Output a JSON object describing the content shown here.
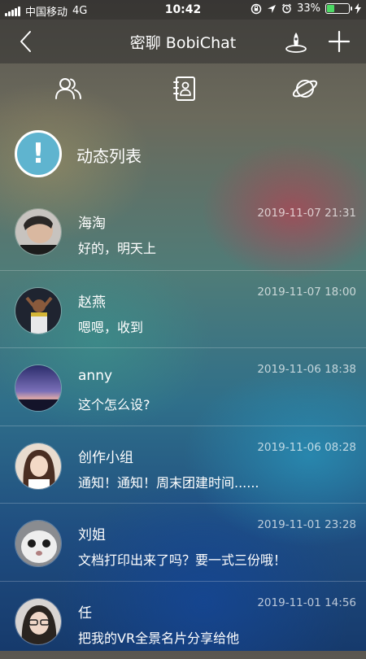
{
  "status_bar": {
    "carrier": "中国移动",
    "network": "4G",
    "time": "10:42",
    "battery_text": "33%",
    "battery_level": 0.33,
    "icons": [
      "signal-icon",
      "lock-rotation-icon",
      "location-icon",
      "alarm-icon",
      "battery-icon",
      "charging-icon"
    ]
  },
  "nav": {
    "title": "密聊 BobiChat",
    "icons": [
      "back-icon",
      "rocket-icon",
      "add-icon"
    ]
  },
  "tabs": [
    {
      "icon": "contacts-icon"
    },
    {
      "icon": "address-book-icon"
    },
    {
      "icon": "planet-icon"
    }
  ],
  "feed_header": {
    "title": "动态列表",
    "icon": "info-icon"
  },
  "conversations": [
    {
      "name": "海淘",
      "message": "好的，明天上",
      "time": "2019-11-07 21:31"
    },
    {
      "name": "赵燕",
      "message": "嗯嗯，收到",
      "time": "2019-11-07 18:00"
    },
    {
      "name": "anny",
      "message": "这个怎么设?",
      "time": "2019-11-06 18:38"
    },
    {
      "name": "创作小组",
      "message": "通知！通知！周末团建时间......",
      "time": "2019-11-06 08:28"
    },
    {
      "name": "刘姐",
      "message": "文档打印出来了吗？要一式三份哦！",
      "time": "2019-11-01 23:28"
    },
    {
      "name": "任",
      "message": "把我的VR全景名片分享给他",
      "time": "2019-11-01 14:56"
    }
  ],
  "colors": {
    "battery_fill": "#4cd964",
    "info_icon_bg": "#5fb4cf"
  }
}
